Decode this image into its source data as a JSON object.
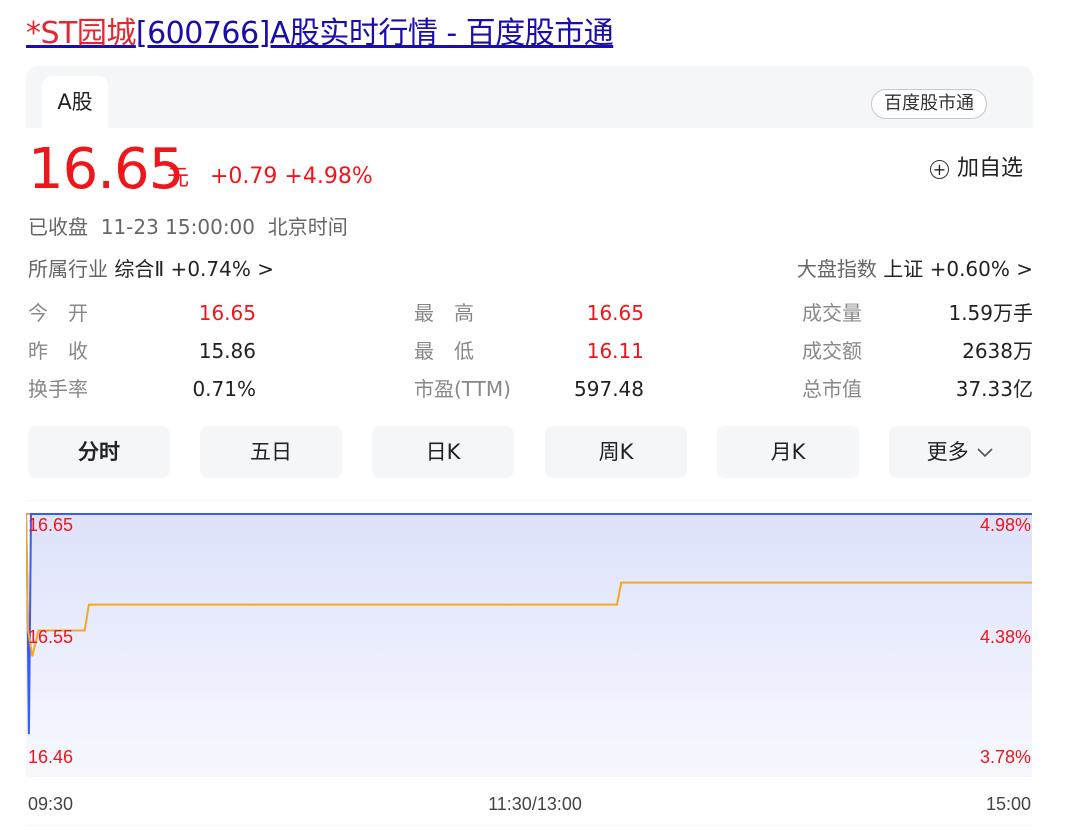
{
  "page": {
    "title_highlight": "*ST园城",
    "title_rest": "[600766]A股实时行情 - 百度股市通"
  },
  "card": {
    "tab_label": "A股",
    "badge": "百度股市通",
    "price": "16.65",
    "unit": "元",
    "change": "+0.79 +4.98%",
    "add_watch": "加自选",
    "status": "已收盘  11-23 15:00:00  北京时间",
    "industry_label": "所属行业",
    "industry_value": "综合Ⅱ +0.74% >",
    "index_label": "大盘指数",
    "index_value": "上证 +0.60% >"
  },
  "stats": [
    {
      "label": "今　开",
      "value": "16.65",
      "color": "red"
    },
    {
      "label": "最　高",
      "value": "16.65",
      "color": "red"
    },
    {
      "label": "成交量",
      "value": "1.59万手",
      "color": "black"
    },
    {
      "label": "昨　收",
      "value": "15.86",
      "color": "black"
    },
    {
      "label": "最　低",
      "value": "16.11",
      "color": "red"
    },
    {
      "label": "成交额",
      "value": "2638万",
      "color": "black"
    },
    {
      "label": "换手率",
      "value": "0.71%",
      "color": "black"
    },
    {
      "label": "市盈(TTM)",
      "value": "597.48",
      "color": "black"
    },
    {
      "label": "总市值",
      "value": "37.33亿",
      "color": "black"
    }
  ],
  "period_tabs": [
    "分时",
    "五日",
    "日K",
    "周K",
    "月K",
    "更多"
  ],
  "colors": {
    "up": "#f0151b",
    "price_line": "#3a5bf0",
    "avg_line": "#f5a623"
  },
  "chart_data": {
    "type": "line",
    "y_ticks": [
      "16.65",
      "16.55",
      "16.46"
    ],
    "pct_ticks": [
      "4.98%",
      "4.38%",
      "3.78%"
    ],
    "x_ticks": [
      "09:30",
      "11:30/13:00",
      "15:00"
    ],
    "ylim": [
      16.46,
      16.65
    ],
    "series": [
      {
        "role": "price",
        "points": [
          [
            0,
            16.65
          ],
          [
            0.3,
            16.6
          ],
          [
            0.7,
            16.48
          ],
          [
            1.2,
            16.65
          ],
          [
            2,
            16.65
          ],
          [
            120,
            16.65
          ],
          [
            240,
            16.65
          ]
        ]
      },
      {
        "role": "average",
        "points": [
          [
            0,
            16.65
          ],
          [
            0.5,
            16.56
          ],
          [
            1.5,
            16.54
          ],
          [
            3,
            16.56
          ],
          [
            14,
            16.56
          ],
          [
            15,
            16.58
          ],
          [
            141,
            16.58
          ],
          [
            142,
            16.597
          ],
          [
            240,
            16.597
          ]
        ]
      }
    ]
  }
}
